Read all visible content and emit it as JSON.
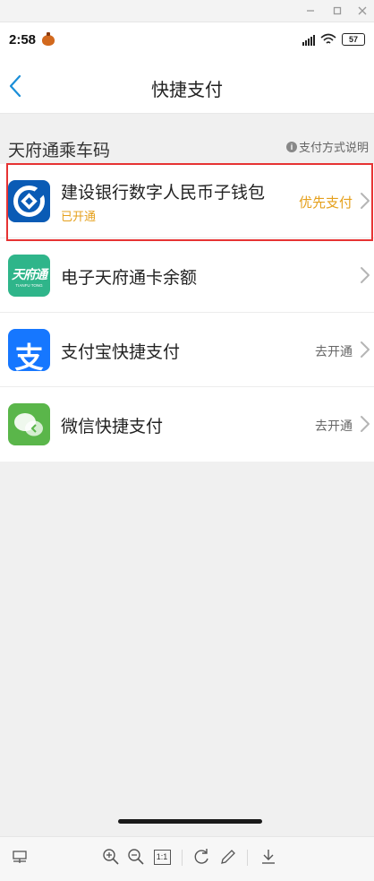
{
  "window": {
    "minimize_icon": "minimize-icon",
    "maximize_icon": "maximize-icon",
    "close_icon": "close-icon"
  },
  "status_bar": {
    "time": "2:58",
    "battery": "57"
  },
  "nav": {
    "title": "快捷支付",
    "back_icon": "chevron-left-icon"
  },
  "section": {
    "title": "天府通乘车码",
    "help_label": "支付方式说明"
  },
  "payment_methods": [
    {
      "title": "建设银行数字人民币子钱包",
      "subtitle": "已开通",
      "status": "优先支付",
      "icon": "ccb-logo"
    },
    {
      "title": "电子天府通卡余额",
      "subtitle": "",
      "status": "",
      "icon": "tianfutong-logo",
      "icon_text": "天府通",
      "icon_subtext": "TIANFU TONG"
    },
    {
      "title": "支付宝快捷支付",
      "subtitle": "",
      "status": "去开通",
      "icon": "alipay-logo",
      "icon_text": "支"
    },
    {
      "title": "微信快捷支付",
      "subtitle": "",
      "status": "去开通",
      "icon": "wechat-logo"
    }
  ],
  "colors": {
    "accent_orange": "#e5a01c",
    "ccb_blue": "#0a5bb5",
    "alipay_blue": "#1677ff",
    "wechat_green": "#5ab64a",
    "tianfutong_green": "#2fb58a",
    "highlight_red": "#e63333",
    "back_blue": "#1a8ed8"
  },
  "viewer_toolbar": {
    "fit_label": "1:1",
    "icons": [
      "thumbnails-icon",
      "zoom-in-icon",
      "zoom-out-icon",
      "actual-size-icon",
      "rotate-icon",
      "edit-icon",
      "download-icon"
    ]
  }
}
